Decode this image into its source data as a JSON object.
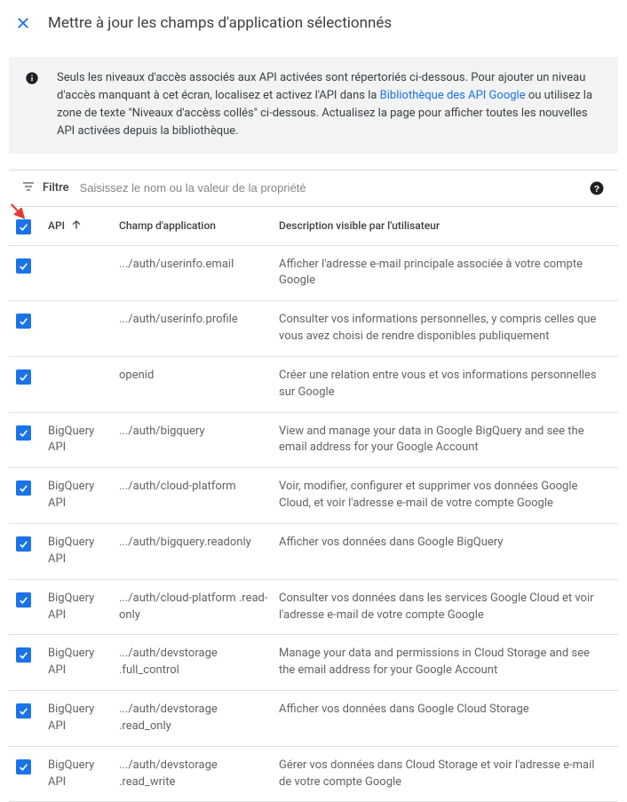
{
  "header": {
    "title": "Mettre à jour les champs d'application sélectionnés"
  },
  "info": {
    "text_before_link": "Seuls les niveaux d'accès associés aux API activées sont répertoriés ci-dessous. Pour ajouter un niveau d'accès manquant à cet écran, localisez et activez l'API dans la ",
    "link_text": "Bibliothèque des API Google",
    "text_after_link": " ou utilisez la zone de texte \"Niveaux d'accèss collés\" ci-dessous. Actualisez la page pour afficher toutes les nouvelles API activées depuis la bibliothèque."
  },
  "filter": {
    "label": "Filtre",
    "placeholder": "Saisissez le nom ou la valeur de la propriété"
  },
  "columns": {
    "api": "API",
    "scope": "Champ d'application",
    "desc": "Description visible par l'utilisateur"
  },
  "rows": [
    {
      "api": "",
      "scope": ".../auth/userinfo.email",
      "desc": "Afficher l'adresse e-mail principale associée à votre compte Google"
    },
    {
      "api": "",
      "scope": ".../auth/userinfo.profile",
      "desc": "Consulter vos informations personnelles, y compris celles que vous avez choisi de rendre disponibles publiquement"
    },
    {
      "api": "",
      "scope": "openid",
      "desc": "Créer une relation entre vous et vos informations personnelles sur Google"
    },
    {
      "api": "BigQuery API",
      "scope": ".../auth/bigquery",
      "desc": "View and manage your data in Google BigQuery and see the email address for your Google Account"
    },
    {
      "api": "BigQuery API",
      "scope": ".../auth/cloud-platform",
      "desc": "Voir, modifier, configurer et supprimer vos données Google Cloud, et voir l'adresse e-mail de votre compte Google"
    },
    {
      "api": "BigQuery API",
      "scope": ".../auth/bigquery.readonly",
      "desc": "Afficher vos données dans Google BigQuery"
    },
    {
      "api": "BigQuery API",
      "scope": ".../auth/cloud-platform .read-only",
      "desc": "Consulter vos données dans les services Google Cloud et voir l'adresse e-mail de votre compte Google"
    },
    {
      "api": "BigQuery API",
      "scope": ".../auth/devstorage .full_control",
      "desc": "Manage your data and permissions in Cloud Storage and see the email address for your Google Account"
    },
    {
      "api": "BigQuery API",
      "scope": ".../auth/devstorage .read_only",
      "desc": "Afficher vos données dans Google Cloud Storage"
    },
    {
      "api": "BigQuery API",
      "scope": ".../auth/devstorage .read_write",
      "desc": "Gérer vos données dans Cloud Storage et voir l'adresse e-mail de votre compte Google"
    }
  ]
}
